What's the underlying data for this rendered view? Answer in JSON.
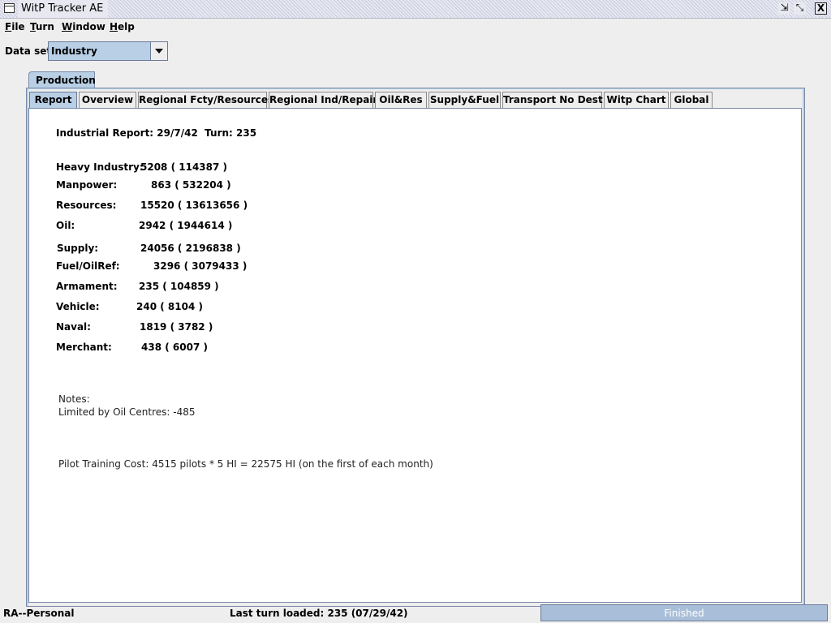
{
  "window": {
    "title": "WitP Tracker AE",
    "minimize_glyph": "⇲",
    "maximize_glyph": "⤡",
    "close_glyph": "X"
  },
  "menu": [
    "File",
    "Turn",
    "Window",
    "Help"
  ],
  "dataset": {
    "label": "Data set:",
    "value": "Industry"
  },
  "outer_tab": "Production",
  "tabs": [
    "Report",
    "Overview",
    "Regional Fcty/Resources",
    "Regional Ind/Repair",
    "Oil&Res",
    "Supply&Fuel",
    "Transport No Dest",
    "Witp Chart",
    "Global"
  ],
  "active_tab": "Report",
  "report": {
    "header": "Industrial Report: 29/7/42  Turn: 235",
    "rows": [
      {
        "label": "Heavy Industry:",
        "value": "5208 ( 114387 )"
      },
      {
        "label": "Manpower:",
        "value": "863 ( 532204 )"
      },
      {
        "label": "Resources:",
        "value": "15520 ( 13613656 )"
      },
      {
        "label": "Oil:",
        "value": "2942 ( 1944614 )"
      },
      {
        "label": "Supply:",
        "value": "24056 ( 2196838 )"
      },
      {
        "label": "Fuel/OilRef:",
        "value": "3296 ( 3079433 )"
      },
      {
        "label": "Armament:",
        "value": "235 ( 104859 )"
      },
      {
        "label": "Vehicle:",
        "value": "240 ( 8104 )"
      },
      {
        "label": "Naval:",
        "value": "1819 ( 3782 )"
      },
      {
        "label": "Merchant:",
        "value": "438 ( 6007 )"
      }
    ],
    "notes_title": "Notes:",
    "notes_line": "Limited by Oil Centres: -485",
    "pilot_training": "Pilot Training Cost: 4515 pilots * 5 HI = 22575 HI (on the first of each month)"
  },
  "status": {
    "left": "RA--Personal",
    "middle": "Last turn loaded: 235 (07/29/42)",
    "progress_text": "Finished",
    "progress_fraction": 1.0
  },
  "colors": {
    "selection": "#b8cfe5",
    "progress": "#a9bfd9"
  }
}
